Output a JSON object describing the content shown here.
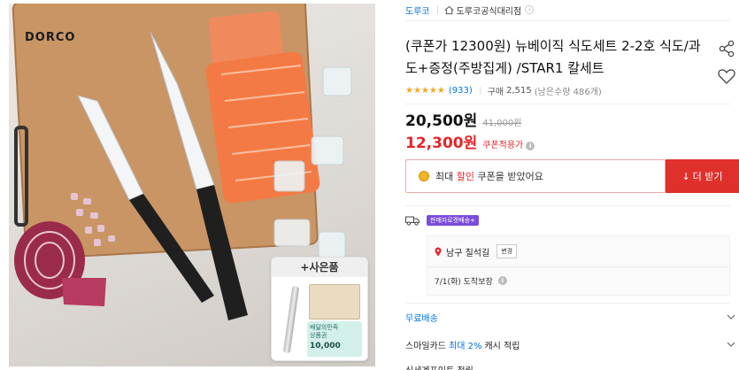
{
  "product_image": {
    "brand_logo": "DORCO",
    "gift": {
      "title": "+사은품",
      "voucher_line1": "배달의민족",
      "voucher_line2": "상품권",
      "voucher_amount": "10,000"
    }
  },
  "breadcrumb": {
    "store": "도루코",
    "official_store": "도루코공식대리점",
    "arrow": "›"
  },
  "product": {
    "title": "(쿠폰가 12300원) 뉴베이직 식도세트 2-2호 식도/과도+증정(주방집게) /STAR1 칼세트",
    "stars": "★★★★★",
    "review_count": "(933)",
    "purchase_label": "구매",
    "purchase_count": "2,515",
    "stock_text": "(남은수량 486개)"
  },
  "price": {
    "sale_price": "20,500원",
    "original_price": "41,000원",
    "coupon_price": "12,300원",
    "coupon_label": "쿠폰적용가",
    "info_glyph": "i"
  },
  "coupon": {
    "text_prefix": "최대",
    "text_highlight": "할인",
    "text_suffix": "쿠폰을 받았어요",
    "download_label": "더 받기",
    "download_arrow": "↓"
  },
  "delivery": {
    "badge": "판매자로켓배송+",
    "address": "남구 칠석길",
    "change_label": "변경",
    "arrival": "7/1(화) 도착보장"
  },
  "benefits": {
    "free_shipping": "무료배송",
    "card_prefix": "스마일카드",
    "card_highlight": "최대 2%",
    "card_suffix": "캐시 적립",
    "cut_row": "신세계포인트 적립"
  },
  "colors": {
    "accent_blue": "#0073e9",
    "price_red": "#e52528",
    "button_red": "#e0302b",
    "star_orange": "#f5a623",
    "badge_purple": "#7c4ddb"
  }
}
